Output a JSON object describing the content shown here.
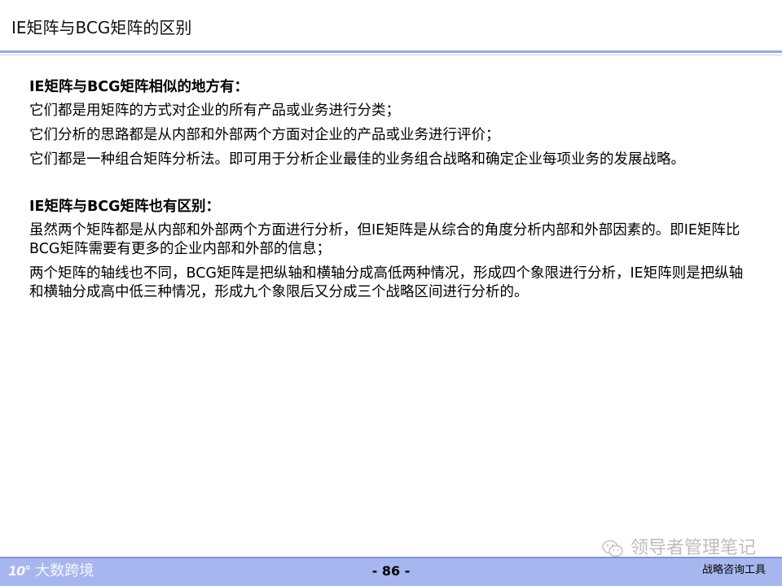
{
  "slide": {
    "title": "IE矩阵与BCG矩阵的区别"
  },
  "content": {
    "section1": {
      "heading": "IE矩阵与BCG矩阵相似的地方有：",
      "items": [
        "它们都是用矩阵的方式对企业的所有产品或业务进行分类；",
        "它们分析的思路都是从内部和外部两个方面对企业的产品或业务进行评价；",
        "它们都是一种组合矩阵分析法。即可用于分析企业最佳的业务组合战略和确定企业每项业务的发展战略。"
      ]
    },
    "section2": {
      "heading": "IE矩阵与BCG矩阵也有区别：",
      "items": [
        "虽然两个矩阵都是从内部和外部两个方面进行分析，但IE矩阵是从综合的角度分析内部和外部因素的。即IE矩阵比BCG矩阵需要有更多的企业内部和外部的信息；",
        "两个矩阵的轴线也不同，BCG矩阵是把纵轴和横轴分成高低两种情况，形成四个象限进行分析，IE矩阵则是把纵轴和横轴分成高中低三种情况，形成九个象限后又分成三个战略区间进行分析的。"
      ]
    }
  },
  "footer": {
    "page_number": "- 86 -",
    "right_text": "战略咨询工具",
    "left_logo_mark": "10°",
    "left_logo_text": "大数跨境"
  },
  "watermark": {
    "text": "领导者管理笔记",
    "icon": "wechat-icon"
  },
  "colors": {
    "accent": "#9aa8e0",
    "footer_bg": "#a7b6ef"
  }
}
